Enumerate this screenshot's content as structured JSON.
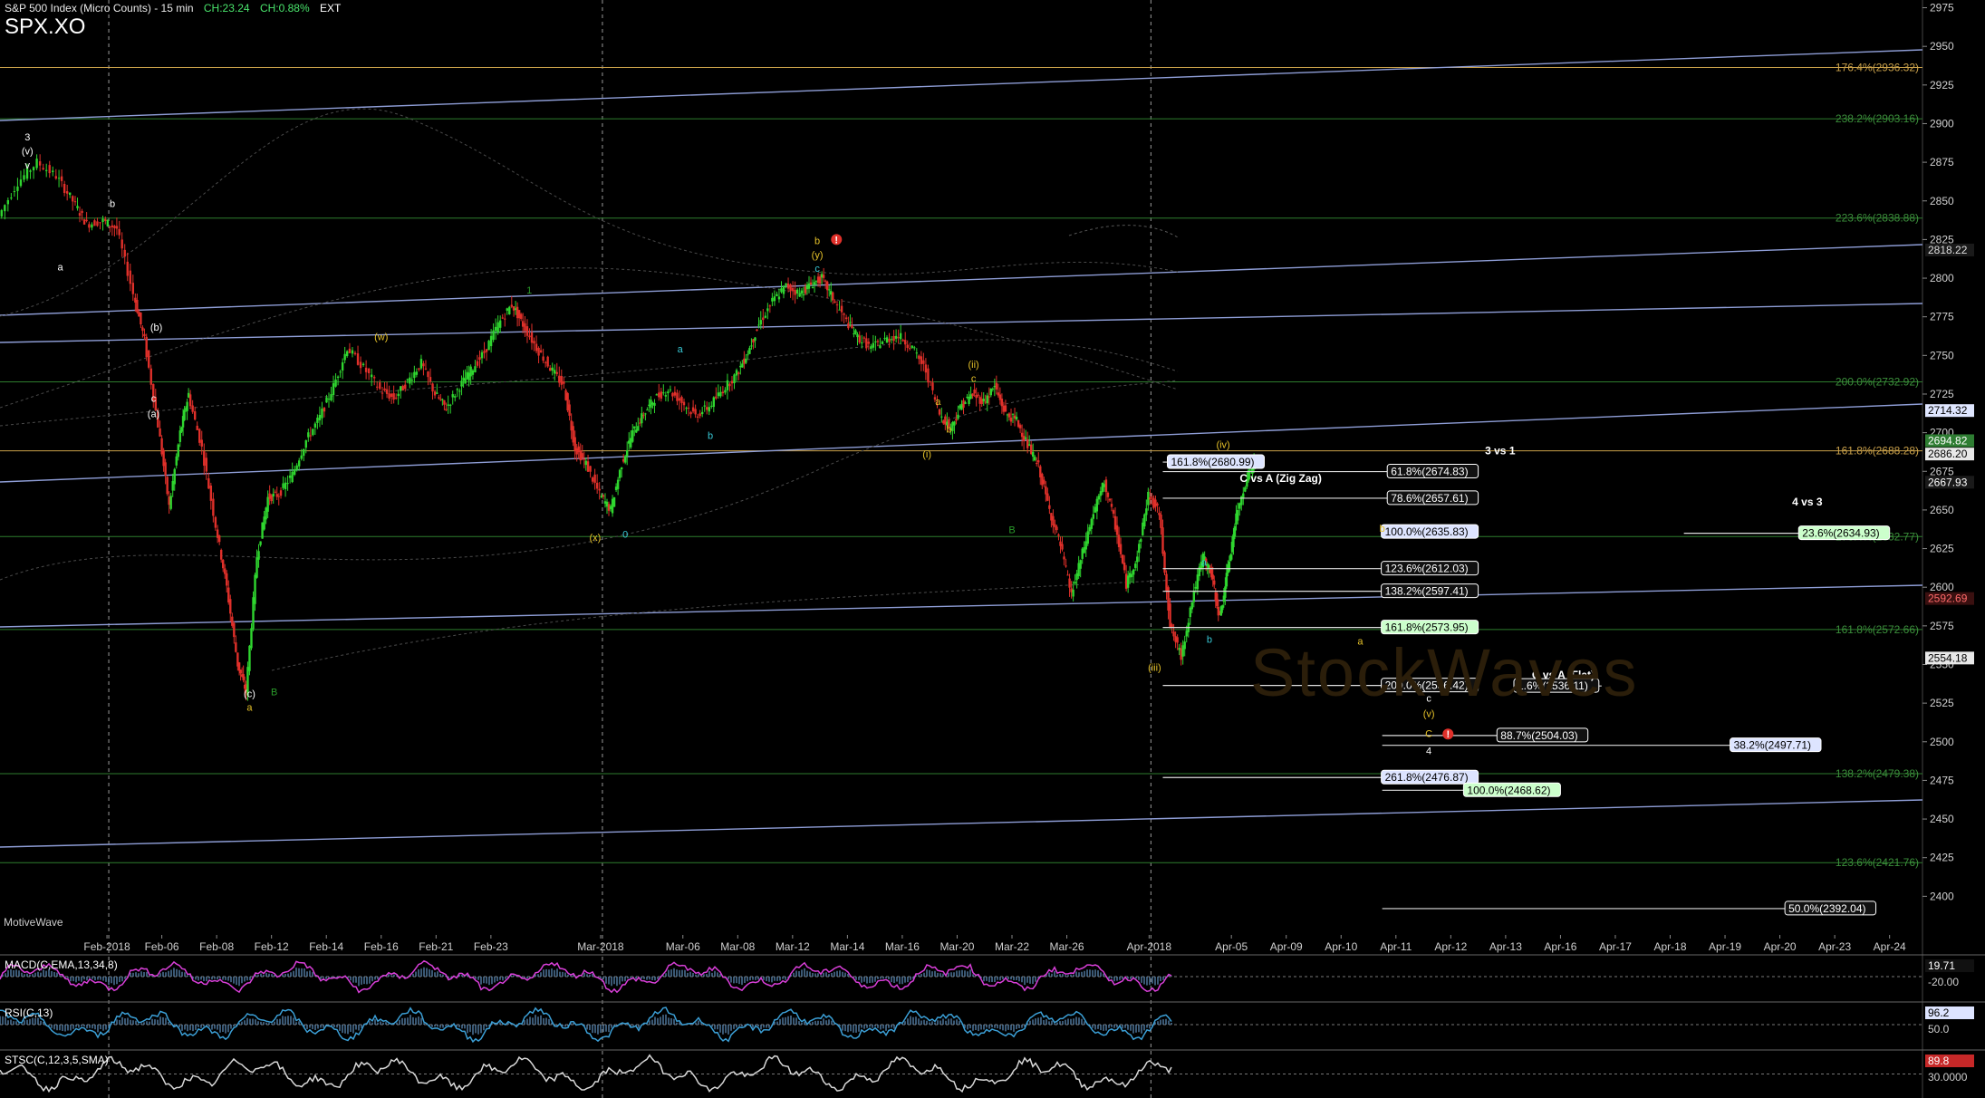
{
  "header": {
    "title": "S&P 500 Index (Micro Counts) - 15 min",
    "change": "CH:23.24",
    "change_pct": "CH:0.88%",
    "session": "EXT",
    "symbol": "SPX.XO"
  },
  "footer": {
    "brand": "MotiveWave",
    "watermark": "StockWaves"
  },
  "colors": {
    "background": "#000000",
    "up_candle": "#2fd62f",
    "down_candle": "#e0302a",
    "trendline": "#8e9dd6",
    "fib_green": "#2e7d2e",
    "fib_orange": "#c9a04a",
    "wave_yellow": "#e6c229",
    "wave_cyan": "#38c9d6",
    "wave_white": "#ffffff",
    "wave_green": "#2a9a2a",
    "alert_red": "#e0302a"
  },
  "chart_data": {
    "type": "line",
    "title": "S&P 500 Index (Micro Counts) - 15 min",
    "ylabel": "",
    "ylim": [
      2375,
      2980
    ],
    "yticks": [
      2975,
      2950,
      2925,
      2900,
      2875,
      2850,
      2825,
      2800,
      2775,
      2750,
      2725,
      2700,
      2675,
      2650,
      2625,
      2600,
      2575,
      2550,
      2525,
      2500,
      2475,
      2450,
      2425,
      2400
    ],
    "xticks": [
      {
        "label": "Feb-2018",
        "t": 2
      },
      {
        "label": "Feb-06",
        "t": 4
      },
      {
        "label": "Feb-08",
        "t": 6
      },
      {
        "label": "Feb-12",
        "t": 8
      },
      {
        "label": "Feb-14",
        "t": 10
      },
      {
        "label": "Feb-16",
        "t": 12
      },
      {
        "label": "Feb-21",
        "t": 14
      },
      {
        "label": "Feb-23",
        "t": 16
      },
      {
        "label": "Mar-2018",
        "t": 20
      },
      {
        "label": "Mar-06",
        "t": 23
      },
      {
        "label": "Mar-08",
        "t": 25
      },
      {
        "label": "Mar-12",
        "t": 27
      },
      {
        "label": "Mar-14",
        "t": 29
      },
      {
        "label": "Mar-16",
        "t": 31
      },
      {
        "label": "Mar-20",
        "t": 33
      },
      {
        "label": "Mar-22",
        "t": 35
      },
      {
        "label": "Mar-26",
        "t": 37
      },
      {
        "label": "Apr-2018",
        "t": 40
      },
      {
        "label": "Apr-05",
        "t": 43
      },
      {
        "label": "Apr-09",
        "t": 45
      },
      {
        "label": "Apr-10",
        "t": 47
      },
      {
        "label": "Apr-11",
        "t": 49
      },
      {
        "label": "Apr-12",
        "t": 51
      },
      {
        "label": "Apr-13",
        "t": 53
      },
      {
        "label": "Apr-16",
        "t": 55
      },
      {
        "label": "Apr-17",
        "t": 57
      },
      {
        "label": "Apr-18",
        "t": 59
      },
      {
        "label": "Apr-19",
        "t": 61
      },
      {
        "label": "Apr-20",
        "t": 63
      },
      {
        "label": "Apr-23",
        "t": 65
      },
      {
        "label": "Apr-24",
        "t": 67
      }
    ],
    "xlim": [
      -1.9,
      68.2
    ],
    "price_path": [
      [
        -1.9,
        2840
      ],
      [
        -1.2,
        2862
      ],
      [
        -0.5,
        2875
      ],
      [
        0.2,
        2866
      ],
      [
        0.8,
        2850
      ],
      [
        1.3,
        2835
      ],
      [
        1.9,
        2837
      ],
      [
        2.4,
        2832
      ],
      [
        3.0,
        2790
      ],
      [
        3.4,
        2760
      ],
      [
        3.9,
        2705
      ],
      [
        4.3,
        2652
      ],
      [
        4.7,
        2700
      ],
      [
        5.0,
        2725
      ],
      [
        5.5,
        2690
      ],
      [
        6.0,
        2640
      ],
      [
        6.4,
        2600
      ],
      [
        6.8,
        2550
      ],
      [
        7.1,
        2532
      ],
      [
        7.5,
        2620
      ],
      [
        7.9,
        2658
      ],
      [
        8.3,
        2660
      ],
      [
        8.8,
        2673
      ],
      [
        9.3,
        2695
      ],
      [
        9.8,
        2710
      ],
      [
        10.3,
        2730
      ],
      [
        10.8,
        2755
      ],
      [
        11.4,
        2742
      ],
      [
        12.0,
        2728
      ],
      [
        12.5,
        2722
      ],
      [
        13.0,
        2733
      ],
      [
        13.5,
        2745
      ],
      [
        14.0,
        2725
      ],
      [
        14.4,
        2716
      ],
      [
        14.9,
        2730
      ],
      [
        15.3,
        2740
      ],
      [
        15.8,
        2752
      ],
      [
        16.3,
        2770
      ],
      [
        16.8,
        2783
      ],
      [
        17.2,
        2770
      ],
      [
        17.7,
        2755
      ],
      [
        18.2,
        2742
      ],
      [
        18.7,
        2730
      ],
      [
        19.1,
        2690
      ],
      [
        19.5,
        2680
      ],
      [
        20.0,
        2660
      ],
      [
        20.4,
        2650
      ],
      [
        20.8,
        2680
      ],
      [
        21.2,
        2700
      ],
      [
        21.6,
        2712
      ],
      [
        22.0,
        2722
      ],
      [
        22.5,
        2728
      ],
      [
        23.0,
        2720
      ],
      [
        23.5,
        2711
      ],
      [
        24.0,
        2717
      ],
      [
        24.5,
        2728
      ],
      [
        25.0,
        2738
      ],
      [
        25.4,
        2752
      ],
      [
        25.8,
        2770
      ],
      [
        26.3,
        2785
      ],
      [
        26.8,
        2795
      ],
      [
        27.3,
        2790
      ],
      [
        27.7,
        2796
      ],
      [
        28.1,
        2800
      ],
      [
        28.5,
        2787
      ],
      [
        29.0,
        2772
      ],
      [
        29.4,
        2762
      ],
      [
        29.9,
        2755
      ],
      [
        30.4,
        2760
      ],
      [
        30.9,
        2763
      ],
      [
        31.4,
        2755
      ],
      [
        31.9,
        2740
      ],
      [
        32.4,
        2712
      ],
      [
        32.8,
        2703
      ],
      [
        33.2,
        2718
      ],
      [
        33.6,
        2725
      ],
      [
        34.0,
        2720
      ],
      [
        34.4,
        2730
      ],
      [
        34.8,
        2712
      ],
      [
        35.2,
        2708
      ],
      [
        35.6,
        2692
      ],
      [
        36.0,
        2678
      ],
      [
        36.4,
        2650
      ],
      [
        36.8,
        2627
      ],
      [
        37.2,
        2595
      ],
      [
        37.6,
        2622
      ],
      [
        38.0,
        2648
      ],
      [
        38.4,
        2668
      ],
      [
        38.8,
        2640
      ],
      [
        39.2,
        2602
      ],
      [
        39.6,
        2620
      ],
      [
        40.0,
        2660
      ],
      [
        40.4,
        2648
      ],
      [
        40.8,
        2575
      ],
      [
        41.2,
        2555
      ],
      [
        41.6,
        2592
      ],
      [
        42.0,
        2620
      ],
      [
        42.3,
        2608
      ],
      [
        42.6,
        2580
      ],
      [
        42.9,
        2612
      ],
      [
        43.2,
        2645
      ],
      [
        43.6,
        2672
      ],
      [
        43.9,
        2681
      ]
    ],
    "horizontal_levels_green": [
      {
        "price": 2903.16,
        "label": "238.2%(2903.16)"
      },
      {
        "price": 2838.88,
        "label": "223.6%(2838.88)"
      },
      {
        "price": 2732.92,
        "label": "200.0%(2732.92)"
      },
      {
        "price": 2632.77,
        "label": "176.4%(2632.77)"
      },
      {
        "price": 2572.66,
        "label": "161.8%(2572.66)"
      },
      {
        "price": 2479.38,
        "label": "138.2%(2479.38)"
      },
      {
        "price": 2421.76,
        "label": "123.6%(2421.76)"
      }
    ],
    "horizontal_levels_orange": [
      {
        "price": 2936.32,
        "label": "176.4%(2936.32)"
      },
      {
        "price": 2688.28,
        "label": "161.8%(2688.28)"
      }
    ],
    "price_badges": [
      {
        "price": 2818.22,
        "label": "2818.22",
        "bg": "#1a1a1a",
        "fg": "#dddddd"
      },
      {
        "price": 2714.32,
        "label": "2714.32",
        "bg": "#dfe6ff",
        "fg": "#000000"
      },
      {
        "price": 2694.82,
        "label": "2694.82",
        "bg": "#2e7d32",
        "fg": "#ffffff"
      },
      {
        "price": 2686.2,
        "label": "2686.20",
        "bg": "#e8e8e8",
        "fg": "#000000"
      },
      {
        "price": 2667.93,
        "label": "2667.93",
        "bg": "#1a1a1a",
        "fg": "#ffffff"
      },
      {
        "price": 2592.69,
        "label": "2592.69",
        "bg": "#3a1010",
        "fg": "#ff6a6a"
      },
      {
        "price": 2554.18,
        "label": "2554.18",
        "bg": "#e8e8e8",
        "fg": "#000000"
      }
    ],
    "fib_boxes": [
      {
        "t1": 40.5,
        "t2": 43.6,
        "lbl_t": 44.2,
        "price": 2680.99,
        "label": "161.8%(2680.99)",
        "style": "blue"
      },
      {
        "t1": 40.5,
        "t2": 52.0,
        "lbl_t": 52.0,
        "price": 2674.83,
        "label": "61.8%(2674.83)",
        "style": "dark"
      },
      {
        "t1": 40.5,
        "t2": 52.0,
        "lbl_t": 52.0,
        "price": 2657.61,
        "label": "78.6%(2657.61)",
        "style": "dark"
      },
      {
        "t1": 48.5,
        "t2": 52.0,
        "lbl_t": 52.0,
        "price": 2635.83,
        "label": "100.0%(2635.83)",
        "style": "blue"
      },
      {
        "t1": 40.5,
        "t2": 52.0,
        "lbl_t": 52.0,
        "price": 2612.03,
        "label": "123.6%(2612.03)",
        "style": "dark"
      },
      {
        "t1": 40.5,
        "t2": 52.0,
        "lbl_t": 52.0,
        "price": 2597.41,
        "label": "138.2%(2597.41)",
        "style": "dark"
      },
      {
        "t1": 40.5,
        "t2": 52.0,
        "lbl_t": 52.0,
        "price": 2573.95,
        "label": "161.8%(2573.95)",
        "style": "green"
      },
      {
        "t1": 40.5,
        "t2": 52.0,
        "lbl_t": 52.0,
        "price": 2536.42,
        "label": "200.0%(2536.42)",
        "style": "dark"
      },
      {
        "t1": 55.0,
        "t2": 56.5,
        "lbl_t": 56.4,
        "price": 2536.11,
        "label": "1.6%(2536.11)",
        "style": "dark"
      },
      {
        "t1": 48.5,
        "t2": 56.0,
        "lbl_t": 56.0,
        "price": 2504.03,
        "label": "88.7%(2504.03)",
        "style": "dark"
      },
      {
        "t1": 48.5,
        "t2": 64.5,
        "lbl_t": 64.5,
        "price": 2497.71,
        "label": "38.2%(2497.71)",
        "style": "blue"
      },
      {
        "t1": 40.5,
        "t2": 52.0,
        "lbl_t": 52.0,
        "price": 2476.87,
        "label": "261.8%(2476.87)",
        "style": "blue"
      },
      {
        "t1": 48.5,
        "t2": 55.0,
        "lbl_t": 55.0,
        "price": 2468.62,
        "label": "100.0%(2468.62)",
        "style": "green"
      },
      {
        "t1": 59.5,
        "t2": 67.0,
        "lbl_t": 67.0,
        "price": 2634.93,
        "label": "23.6%(2634.93)",
        "style": "green"
      },
      {
        "t1": 48.5,
        "t2": 66.5,
        "lbl_t": 66.5,
        "price": 2392.04,
        "label": "50.0%(2392.04)",
        "style": "dark"
      }
    ],
    "annotations": [
      {
        "t": 52.8,
        "price": 2686,
        "text": "3 vs 1",
        "color": "#ffffff",
        "bold": true
      },
      {
        "t": 44.8,
        "price": 2668,
        "text": "C vs A (Zig Zag)",
        "color": "#ffffff",
        "bold": true
      },
      {
        "t": 64.0,
        "price": 2653,
        "text": "4 vs 3",
        "color": "#ffffff",
        "bold": true
      },
      {
        "t": 55.1,
        "price": 2541,
        "text": "C vs A (Flat)",
        "color": "#ffffff",
        "bold": true
      }
    ],
    "wave_labels": [
      {
        "t": -0.9,
        "price": 2889,
        "text": "3",
        "color": "#ffffff"
      },
      {
        "t": -0.9,
        "price": 2880,
        "text": "(v)",
        "color": "#ffffff"
      },
      {
        "t": -0.9,
        "price": 2871,
        "text": "v",
        "color": "#ffffff"
      },
      {
        "t": 0.3,
        "price": 2805,
        "text": "a",
        "color": "#ffffff"
      },
      {
        "t": 2.2,
        "price": 2846,
        "text": "b",
        "color": "#ffffff"
      },
      {
        "t": 3.8,
        "price": 2766,
        "text": "(b)",
        "color": "#ffffff"
      },
      {
        "t": 3.7,
        "price": 2720,
        "text": "c",
        "color": "#ffffff"
      },
      {
        "t": 3.7,
        "price": 2710,
        "text": "(a)",
        "color": "#ffffff"
      },
      {
        "t": 7.2,
        "price": 2529,
        "text": "(c)",
        "color": "#ffffff"
      },
      {
        "t": 7.2,
        "price": 2520,
        "text": "a",
        "color": "#e6c229"
      },
      {
        "t": 8.1,
        "price": 2530,
        "text": "B",
        "color": "#2a9a2a"
      },
      {
        "t": 12.0,
        "price": 2760,
        "text": "(w)",
        "color": "#e6c229"
      },
      {
        "t": 17.4,
        "price": 2790,
        "text": "1",
        "color": "#2a9a2a"
      },
      {
        "t": 19.8,
        "price": 2630,
        "text": "(x)",
        "color": "#e6c229"
      },
      {
        "t": 22.9,
        "price": 2752,
        "text": "a",
        "color": "#38c9d6"
      },
      {
        "t": 24.0,
        "price": 2696,
        "text": "b",
        "color": "#38c9d6"
      },
      {
        "t": 20.9,
        "price": 2632,
        "text": "0",
        "color": "#38c9d6"
      },
      {
        "t": 27.9,
        "price": 2822,
        "text": "b",
        "color": "#e6c229"
      },
      {
        "t": 27.9,
        "price": 2813,
        "text": "(y)",
        "color": "#e6c229"
      },
      {
        "t": 27.9,
        "price": 2804,
        "text": "c",
        "color": "#38c9d6"
      },
      {
        "t": 33.6,
        "price": 2742,
        "text": "(ii)",
        "color": "#e6c229"
      },
      {
        "t": 33.6,
        "price": 2733,
        "text": "c",
        "color": "#e6c229"
      },
      {
        "t": 32.3,
        "price": 2718,
        "text": "a",
        "color": "#e6c229"
      },
      {
        "t": 32.7,
        "price": 2700,
        "text": "b",
        "color": "#e6c229"
      },
      {
        "t": 31.9,
        "price": 2684,
        "text": "(i)",
        "color": "#e6c229"
      },
      {
        "t": 35.0,
        "price": 2635,
        "text": "B",
        "color": "#2a9a2a"
      },
      {
        "t": 40.2,
        "price": 2546,
        "text": "(iii)",
        "color": "#e6c229"
      },
      {
        "t": 42.0,
        "price": 2614,
        "text": "a",
        "color": "#38c9d6"
      },
      {
        "t": 42.2,
        "price": 2564,
        "text": "b",
        "color": "#38c9d6"
      },
      {
        "t": 42.7,
        "price": 2690,
        "text": "(iv)",
        "color": "#e6c229"
      },
      {
        "t": 47.7,
        "price": 2563,
        "text": "a",
        "color": "#e6c229"
      },
      {
        "t": 48.5,
        "price": 2636,
        "text": "b",
        "color": "#e6c229"
      },
      {
        "t": 50.2,
        "price": 2526,
        "text": "c",
        "color": "#ffffff"
      },
      {
        "t": 50.2,
        "price": 2516,
        "text": "(v)",
        "color": "#e6c229"
      },
      {
        "t": 50.2,
        "price": 2503,
        "text": "C",
        "color": "#e6c229"
      },
      {
        "t": 50.2,
        "price": 2492,
        "text": "4",
        "color": "#ffffff"
      }
    ],
    "indicators": [
      {
        "label": "MACD(C,EMA,13,34,8)",
        "value": "19.71",
        "value2": "-20.00",
        "color": "#d93fd9"
      },
      {
        "label": "RSI(C,13)",
        "value": "96.2",
        "value2": "50.0",
        "color": "#3b9fd6"
      },
      {
        "label": "STSC(C,12,3,5,SMA)",
        "value": "89.8",
        "value2": "30.0000",
        "color": "#d8d8d8"
      }
    ]
  }
}
